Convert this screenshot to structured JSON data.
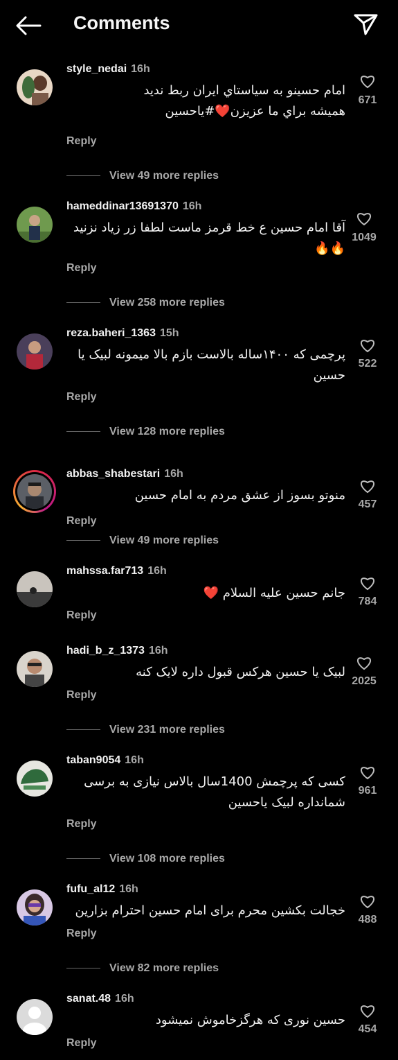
{
  "header": {
    "title": "Comments",
    "back_icon": "arrow-left-icon",
    "share_icon": "send-icon"
  },
  "reply_label": "Reply",
  "comments": [
    {
      "username": "style_nedai",
      "time": "16h",
      "text_lines": [
        "امام حسینو به سیاستاي ایران ربط ندید",
        "همیشه براي ما عزیزن❤️#یاحسین"
      ],
      "likes": "671",
      "more_replies": "View 49 more replies"
    },
    {
      "username": "hameddinar13691370",
      "time": "16h",
      "text_lines": [
        "آقا امام حسین ع خط قرمز ماست لطفا زر زیاد نزنید",
        "🔥🔥"
      ],
      "likes": "1049",
      "more_replies": "View 258 more replies"
    },
    {
      "username": "reza.baheri_1363",
      "time": "15h",
      "text_lines": [
        "پرچمی که ۱۴۰۰ساله بالاست بازم بالا میمونه لبیک یا",
        "حسین"
      ],
      "likes": "522",
      "more_replies": "View 128 more replies"
    },
    {
      "username": "abbas_shabestari",
      "time": "16h",
      "text_lines": [
        "منوتو بسوز از عشق مردم به امام حسین"
      ],
      "likes": "457",
      "more_replies": "View 49 more replies"
    },
    {
      "username": "mahssa.far713",
      "time": "16h",
      "text_lines": [
        "جانم حسین علیه السلام ❤️"
      ],
      "likes": "784",
      "more_replies": ""
    },
    {
      "username": "hadi_b_z_1373",
      "time": "16h",
      "text_lines": [
        "لبیک یا حسین هرکس قبول داره لایک کنه"
      ],
      "likes": "2025",
      "more_replies": "View 231 more replies"
    },
    {
      "username": "taban9054",
      "time": "16h",
      "text_lines": [
        "کسی که پرچمش 1400سال بالاس نیازی به برسی",
        "شمانداره لبیک یاحسین"
      ],
      "likes": "961",
      "more_replies": "View 108 more replies"
    },
    {
      "username": "fufu_al12",
      "time": "16h",
      "text_lines": [
        "خجالت بکشین  محرم  برای امام  حسین احترام بزارین"
      ],
      "likes": "488",
      "more_replies": "View 82 more replies"
    },
    {
      "username": "sanat.48",
      "time": "16h",
      "text_lines": [
        "حسین نوری که هرگزخاموش نمیشود"
      ],
      "likes": "454",
      "more_replies": ""
    }
  ]
}
